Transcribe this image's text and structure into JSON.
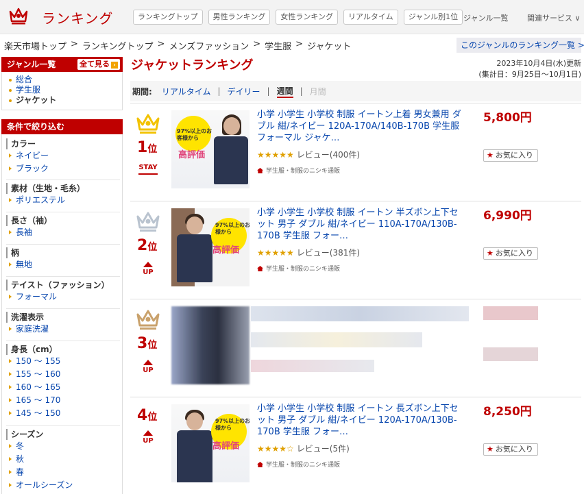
{
  "header": {
    "logo_text": "ランキング",
    "nav": [
      "ランキングトップ",
      "男性ランキング",
      "女性ランキング",
      "リアルタイム",
      "ジャンル別1位"
    ],
    "genre_list": "ジャンル一覧",
    "related": "関連サービス ∨"
  },
  "breadcrumb": [
    "楽天市場トップ",
    "ランキングトップ",
    "メンズファッション",
    "学生服",
    "ジャケット"
  ],
  "breadcrumb_sep": ">",
  "genre_ranking_link": "このジャンルのランキング一覧 >>",
  "sidebar": {
    "genre_head": "ジャンル一覧",
    "see_all": "全て見る",
    "genres": [
      "総合",
      "学生服",
      "ジャケット"
    ],
    "filter_head": "条件で絞り込む",
    "filters": [
      {
        "title": "カラー",
        "items": [
          "ネイビー",
          "ブラック"
        ]
      },
      {
        "title": "素材（生地・毛糸）",
        "items": [
          "ポリエステル"
        ]
      },
      {
        "title": "長さ（袖）",
        "items": [
          "長袖"
        ]
      },
      {
        "title": "柄",
        "items": [
          "無地"
        ]
      },
      {
        "title": "テイスト（ファッション）",
        "items": [
          "フォーマル"
        ]
      },
      {
        "title": "洗濯表示",
        "items": [
          "家庭洗濯"
        ]
      },
      {
        "title": "身長（cm）",
        "items": [
          "150 ～ 155",
          "155 ～ 160",
          "160 ～ 165",
          "165 ～ 170",
          "145 ～ 150"
        ]
      },
      {
        "title": "シーズン",
        "items": [
          "冬",
          "秋",
          "春",
          "オールシーズン"
        ]
      }
    ]
  },
  "main": {
    "title": "ジャケットランキング",
    "updated": "2023年10月4日(水)更新",
    "period_range": "(集計日：9月25日～10月1日)",
    "period_label": "期間:",
    "periods": [
      "リアルタイム",
      "デイリー",
      "週間",
      "月間"
    ],
    "period_sep": "|",
    "active_period": "週間"
  },
  "items": [
    {
      "rank": "1",
      "rank_suffix": "位",
      "move": "STAY",
      "name": "小学 小学生 小学校 制服 イートン上着 男女兼用 ダブル 紺/ネイビー 120A-170A/140B-170B 学生服 フォーマル ジャケ…",
      "stars": "★★★★★",
      "review": "レビュー(400件)",
      "shop": "学生服・制服のニシキ通販",
      "price": "5,800円",
      "fav": "お気に入り",
      "badge": "97%以上のお客様から",
      "hyouka": "高評価",
      "crown_color": "#f2c200"
    },
    {
      "rank": "2",
      "rank_suffix": "位",
      "move": "UP",
      "name": "小学 小学生 小学校 制服 イートン 半ズボン上下セット 男子 ダブル 紺/ネイビー 110A-170A/130B-170B 学生服 フォー…",
      "stars": "★★★★★",
      "review": "レビュー(381件)",
      "shop": "学生服・制服のニシキ通販",
      "price": "6,990円",
      "fav": "お気に入り",
      "badge": "97%以上のお客様から",
      "hyouka": "高評価",
      "crown_color": "#b9c3cf"
    },
    {
      "rank": "3",
      "rank_suffix": "位",
      "move": "UP",
      "crown_color": "#c9a16b"
    },
    {
      "rank": "4",
      "rank_suffix": "位",
      "move": "UP",
      "name": "小学 小学生 小学校 制服 イートン 長ズボン上下セット 男子 ダブル 紺/ネイビー 120A-170A/130B-170B 学生服 フォー…",
      "stars": "★★★★☆",
      "review": "レビュー(5件)",
      "shop": "学生服・制服のニシキ通販",
      "price": "8,250円",
      "fav": "お気に入り",
      "badge": "97%以上のお客様から",
      "hyouka": "高評価"
    }
  ],
  "colors": {
    "accent": "#bf0000",
    "link": "#0645ad"
  }
}
